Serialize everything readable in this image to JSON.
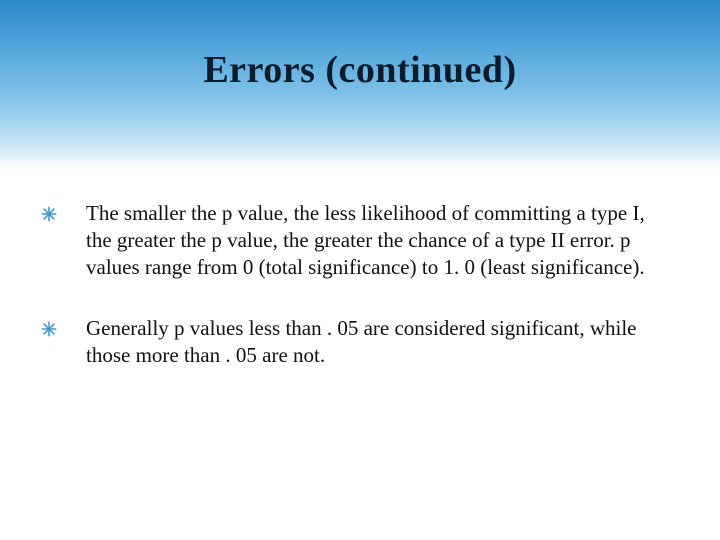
{
  "title": "Errors (continued)",
  "bullets": [
    "The smaller the p value, the less likelihood of committing a type I, the greater the p value, the greater the chance of a type II error.  p values range from 0 (total significance)  to 1. 0 (least significance).",
    "Generally p values less than . 05 are considered significant, while those more than . 05 are not."
  ]
}
